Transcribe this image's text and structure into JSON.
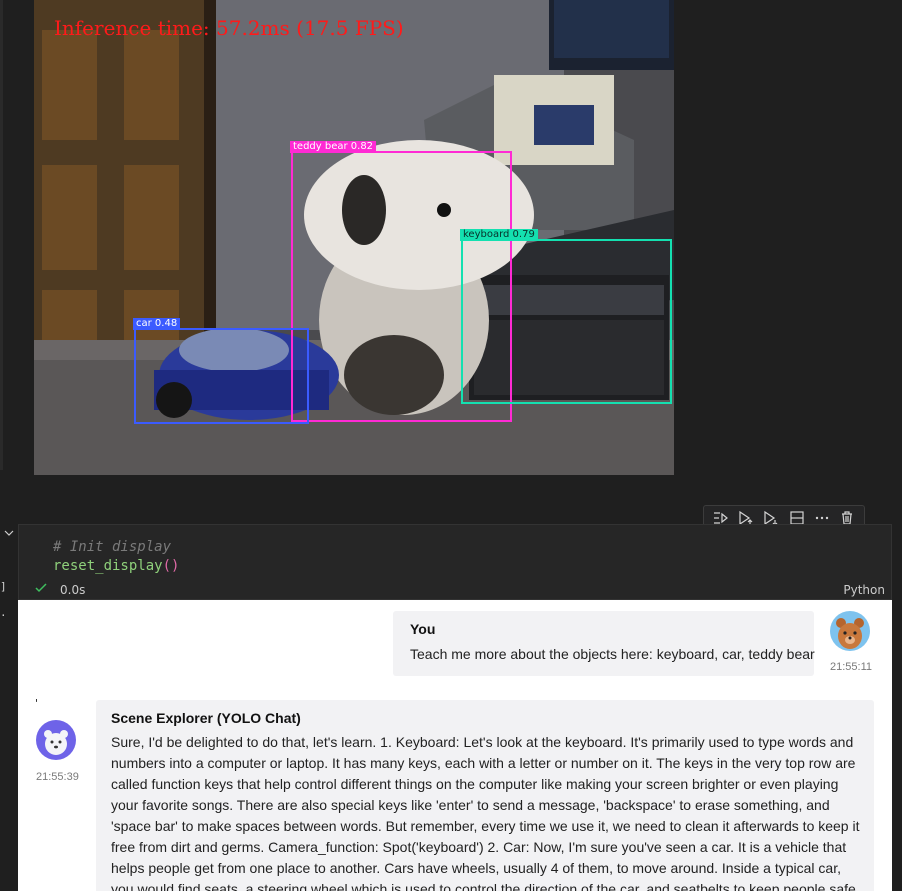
{
  "camera": {
    "inference_text": "Inference time: 57.2ms (17.5 FPS)",
    "detections": [
      {
        "label": "teddy bear 0.82",
        "color": "#ff2ad4"
      },
      {
        "label": "keyboard 0.79",
        "color": "#14e0b0"
      },
      {
        "label": "car 0.48",
        "color": "#3b5bff"
      }
    ]
  },
  "gutter": {
    "left_mark_1": "]",
    "left_mark_2": "."
  },
  "toolbar": {
    "icons": [
      "run-by-line-icon",
      "execute-above-icon",
      "execute-below-icon",
      "split-cell-icon",
      "more-icon",
      "delete-icon"
    ]
  },
  "cell": {
    "comment": "# Init display",
    "code_fn": "reset_display",
    "code_parens": "()",
    "duration": "0.0s",
    "language": "Python"
  },
  "chat": {
    "user": {
      "name": "You",
      "message": "Teach me more about the objects here: keyboard, car, teddy bear",
      "time": "21:55:11"
    },
    "bot": {
      "name": "Scene Explorer (YOLO Chat)",
      "message": "Sure, I'd be delighted to do that, let's learn. 1. Keyboard: Let's look at the keyboard. It's primarily used to type words and numbers into a computer or laptop. It has many keys, each with a letter or number on it. The keys in the very top row are called function keys that help control different things on the computer like making your screen brighter or even playing your favorite songs. There are also special keys like 'enter' to send a message, 'backspace' to erase something, and 'space bar' to make spaces between words. But remember, every time we use it, we need to clean it afterwards to keep it free from dirt and germs. Camera_function: Spot('keyboard') 2. Car: Now, I'm sure you've seen a car. It is a vehicle that helps people get from one place to another. Cars have wheels, usually 4 of them, to move around. Inside a typical car, you would find seats, a steering wheel which is used to control the direction of the car, and seatbelts to keep people safe.",
      "time": "21:55:39",
      "tick": "'"
    }
  }
}
